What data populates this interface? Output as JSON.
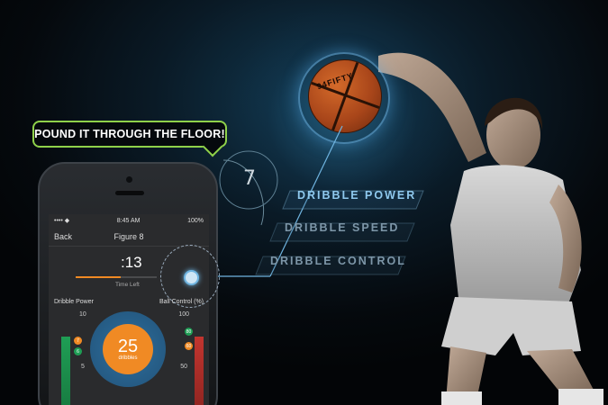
{
  "bubble": {
    "text": "POUND IT THROUGH THE FLOOR!"
  },
  "phone": {
    "status": {
      "carrier": "•••• ◆",
      "time": "8:45 AM",
      "battery": "100%"
    },
    "nav": {
      "back_label": "Back",
      "title": "Figure 8"
    },
    "timer": {
      "value": ":13",
      "label": "Time Left",
      "progress": 0.55
    },
    "stats": {
      "left_label": "Dribble Power",
      "right_label": "Ball Control (%)",
      "left_ticks": [
        "10",
        "5"
      ],
      "right_ticks": [
        "100",
        "50"
      ],
      "left_markers": [
        "7",
        "6"
      ],
      "right_markers": [
        "80",
        "60"
      ]
    },
    "gauge": {
      "value": "25",
      "unit": "dribbles"
    }
  },
  "overlay": {
    "count": "7",
    "metrics": [
      "DRIBBLE POWER",
      "DRIBBLE SPEED",
      "DRIBBLE CONTROL"
    ],
    "ball_brand": "94FIFTY"
  },
  "colors": {
    "accent_green": "#8fd14a",
    "accent_orange": "#f08a24",
    "accent_blue": "#6fb4e0"
  }
}
